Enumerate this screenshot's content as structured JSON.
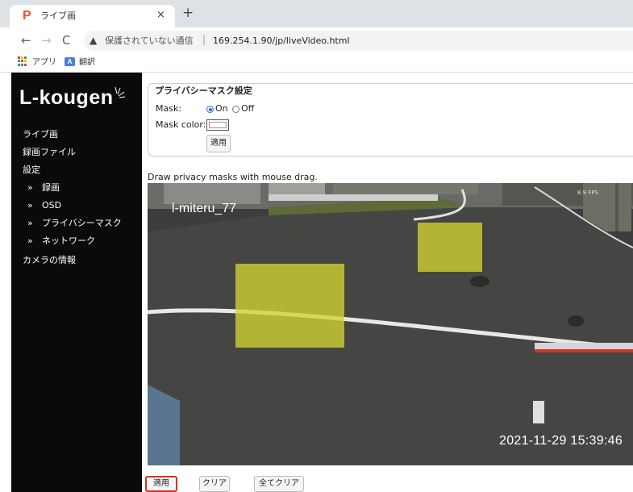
{
  "browser": {
    "tab_title": "ライブ画",
    "tab_favicon": "P",
    "tab_close": "×",
    "new_tab": "+",
    "nav": {
      "back": "←",
      "forward": "→",
      "reload": "C"
    },
    "security_icon": "▲",
    "security_text": "保護されていない通信",
    "url_separator": "|",
    "url": "169.254.1.90/jp/liveVideo.html",
    "bookmarks": {
      "apps_label": "アプリ",
      "translate_label": "翻訳",
      "translate_icon_text": "A"
    }
  },
  "sidebar": {
    "logo": "L-kougen",
    "items": [
      {
        "label": "ライブ画"
      },
      {
        "label": "録画ファイル"
      },
      {
        "label": "設定"
      }
    ],
    "sub_arrow": "»",
    "sub_items": [
      {
        "label": "録画"
      },
      {
        "label": "OSD"
      },
      {
        "label": "プライバシーマスク"
      },
      {
        "label": "ネットワーク"
      }
    ],
    "camera_info": "カメラの情報"
  },
  "privacy_form": {
    "legend": "プライバシーマスク設定",
    "mask_label": "Mask:",
    "on_label": "On",
    "off_label": "Off",
    "mask_enabled": true,
    "color_label": "Mask color:",
    "mask_color": "#ffffff",
    "apply_label": "適用"
  },
  "video": {
    "hint": "Draw privacy masks with mouse drag.",
    "camera_name": "l-miteru_77",
    "fps_text": "8.9 FPS",
    "timestamp": "2021-11-29  15:39:46",
    "mask_fill": "#d2d232"
  },
  "bottom_buttons": {
    "apply": "適用",
    "clear": "クリア",
    "clear_all": "全てクリア"
  }
}
